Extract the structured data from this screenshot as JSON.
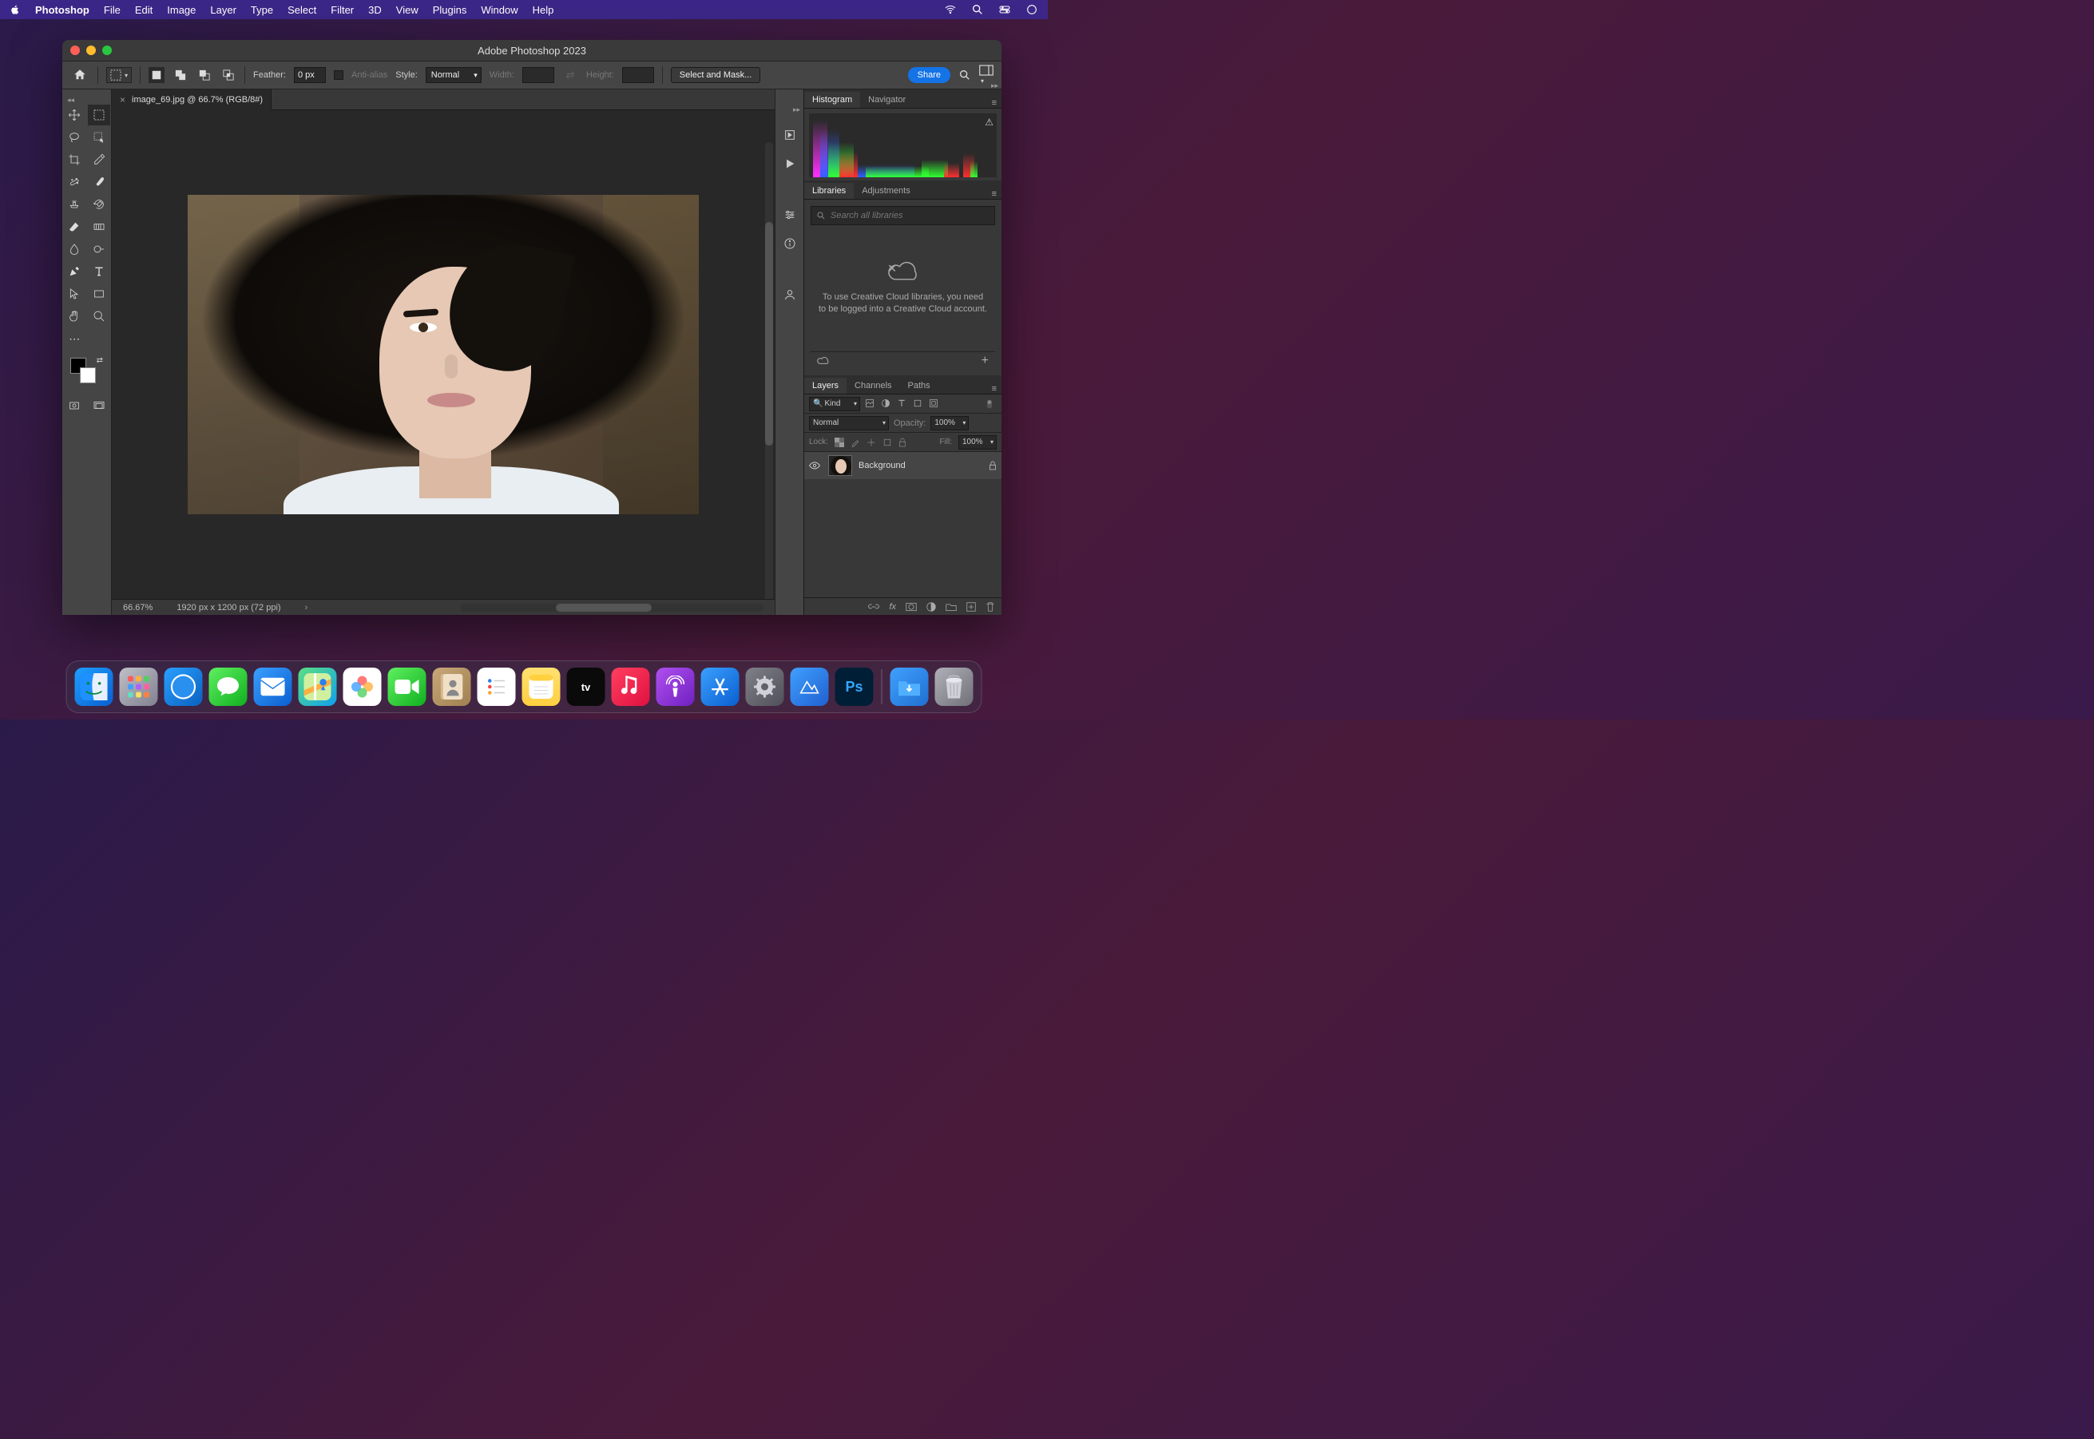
{
  "mac_menubar": {
    "app": "Photoshop",
    "items": [
      "File",
      "Edit",
      "Image",
      "Layer",
      "Type",
      "Select",
      "Filter",
      "3D",
      "View",
      "Plugins",
      "Window",
      "Help"
    ]
  },
  "window": {
    "title": "Adobe Photoshop 2023"
  },
  "options": {
    "feather_label": "Feather:",
    "feather_value": "0 px",
    "antialias_label": "Anti-alias",
    "style_label": "Style:",
    "style_value": "Normal",
    "width_label": "Width:",
    "height_label": "Height:",
    "select_and_mask": "Select and Mask...",
    "share": "Share"
  },
  "doc_tab": {
    "label": "image_69.jpg @ 66.7% (RGB/8#)"
  },
  "status": {
    "zoom": "66.67%",
    "dims": "1920 px x 1200 px (72 ppi)"
  },
  "panels": {
    "histogram": {
      "tab": "Histogram",
      "navigator": "Navigator"
    },
    "libraries": {
      "tab": "Libraries",
      "adjustments": "Adjustments",
      "search_placeholder": "Search all libraries",
      "empty_msg": "To use Creative Cloud libraries, you need to be logged into a Creative Cloud account."
    },
    "layers": {
      "tab": "Layers",
      "channels": "Channels",
      "paths": "Paths",
      "kind": "Kind",
      "blend_mode": "Normal",
      "opacity_label": "Opacity:",
      "opacity_value": "100%",
      "lock_label": "Lock:",
      "fill_label": "Fill:",
      "fill_value": "100%",
      "layer0": "Background"
    }
  },
  "dock": {
    "tv_label": "tv"
  }
}
